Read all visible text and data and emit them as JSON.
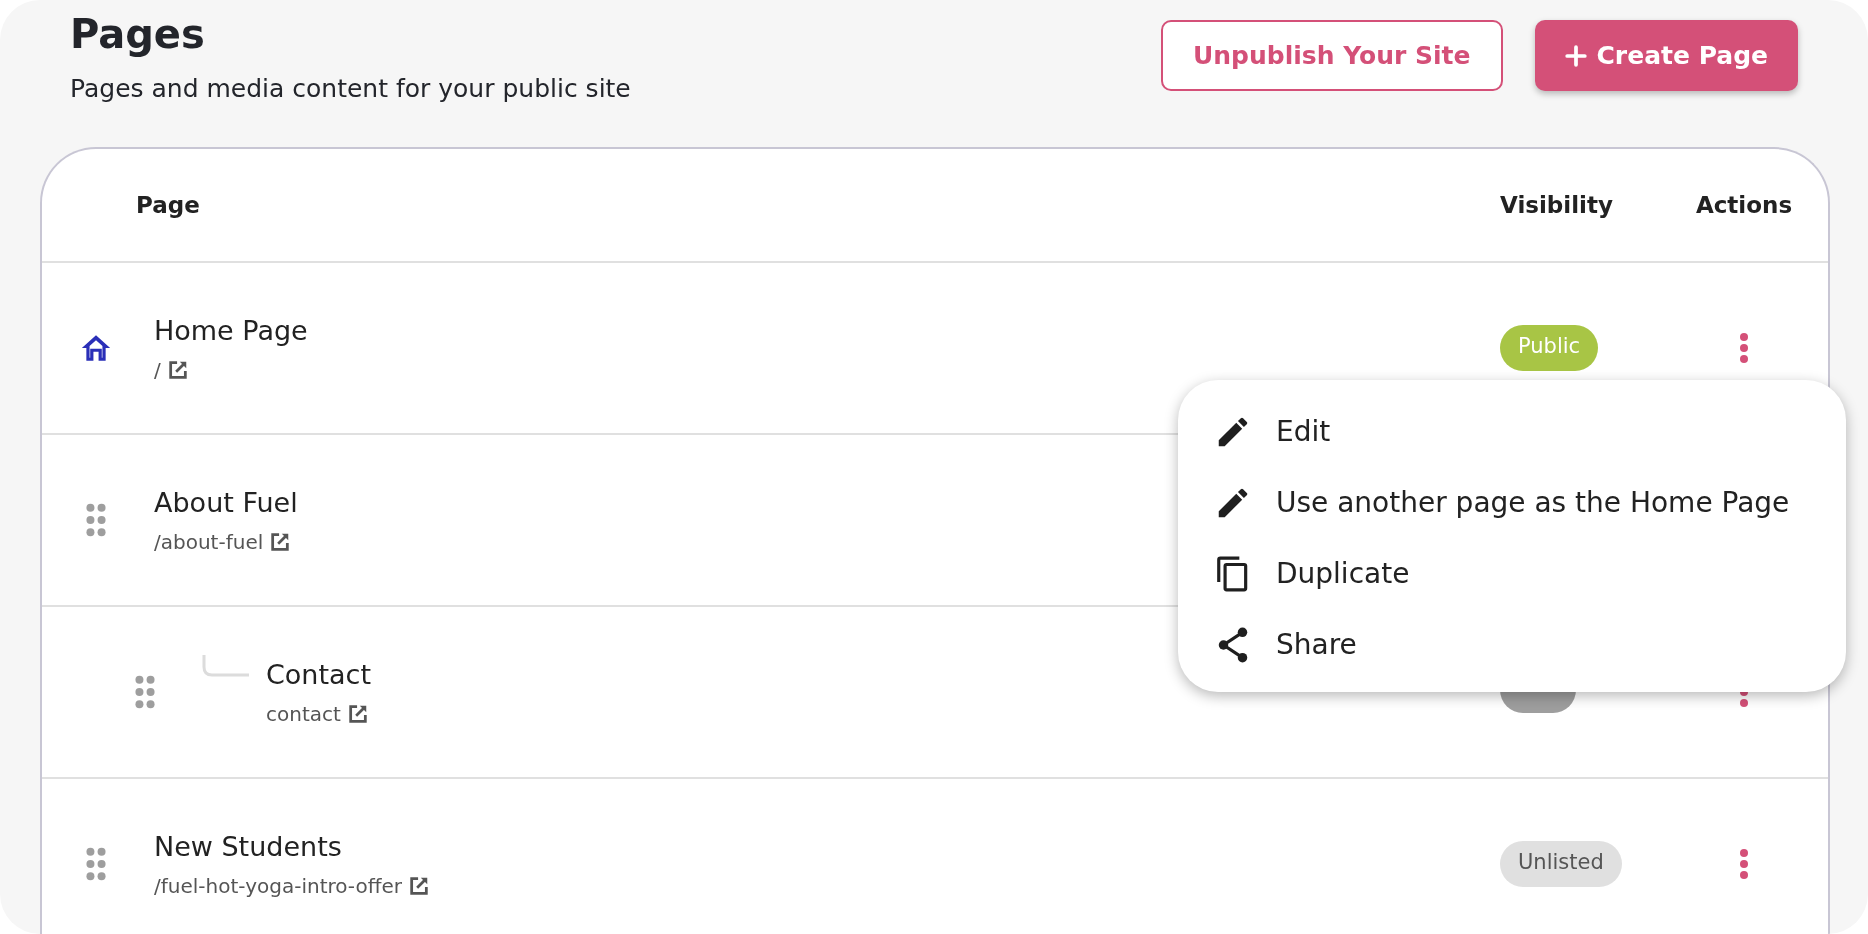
{
  "header": {
    "title": "Pages",
    "subtitle": "Pages and media content for your public site"
  },
  "buttons": [
    {
      "label": "Unpublish Your Site",
      "kind": "outline"
    },
    {
      "label": "Create Page",
      "kind": "primary"
    }
  ],
  "table": {
    "columns": [
      "Page",
      "Visibility",
      "Actions"
    ],
    "rows": [
      {
        "kind": "home",
        "title": "Home Page",
        "path": "/",
        "visibility": {
          "kind": "public",
          "label": "Public"
        }
      },
      {
        "kind": "draggable",
        "title": "About Fuel",
        "path": "/about-fuel",
        "children": [
          {
            "kind": "draggable",
            "title": "Contact",
            "path": "contact",
            "visibility": {
              "kind": "draft"
            }
          }
        ]
      },
      {
        "kind": "draggable",
        "title": "New Students",
        "path": "/fuel-hot-yoga-intro-offer",
        "visibility": {
          "kind": "unlisted",
          "label": "Unlisted"
        }
      }
    ]
  },
  "menu": {
    "items": [
      {
        "kind": "edit",
        "label": "Edit"
      },
      {
        "kind": "edit",
        "label": "Use another page as the Home Page"
      },
      {
        "kind": "duplicate",
        "label": "Duplicate"
      },
      {
        "kind": "share",
        "label": "Share"
      }
    ]
  }
}
